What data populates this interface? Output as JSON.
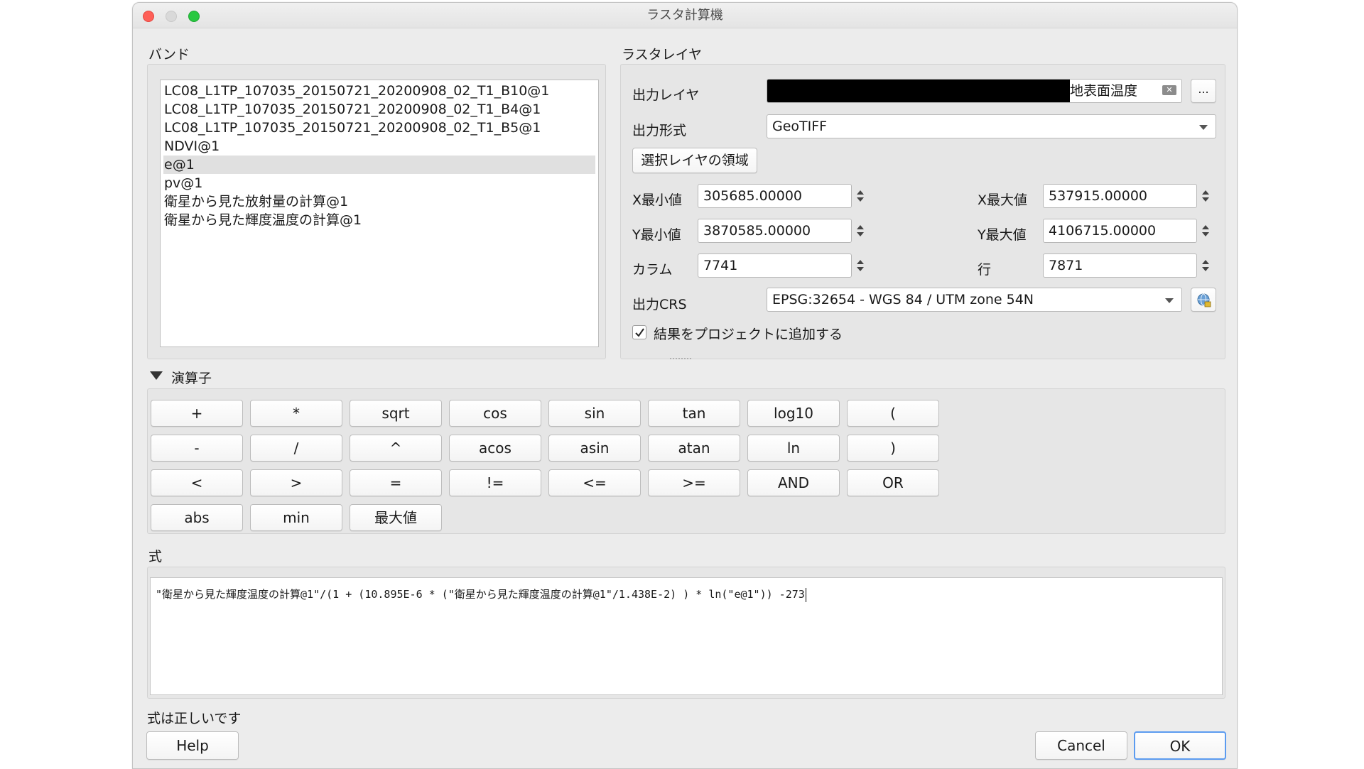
{
  "window": {
    "title": "ラスタ計算機"
  },
  "bands": {
    "label": "バンド",
    "items": [
      "LC08_L1TP_107035_20150721_20200908_02_T1_B10@1",
      "LC08_L1TP_107035_20150721_20200908_02_T1_B4@1",
      "LC08_L1TP_107035_20150721_20200908_02_T1_B5@1",
      "NDVI@1",
      "e@1",
      "pv@1",
      "衛星から見た放射量の計算@1",
      "衛星から見た輝度温度の計算@1"
    ],
    "selected_index": 4
  },
  "raster_layer": {
    "label": "ラスタレイヤ",
    "output_layer_label": "出力レイヤ",
    "output_layer_value": "地表面温度",
    "browse_label": "...",
    "output_format_label": "出力形式",
    "output_format_value": "GeoTIFF",
    "selected_extent_button": "選択レイヤの領域",
    "xmin_label": "X最小値",
    "xmin_value": "305685.00000",
    "xmax_label": "X最大値",
    "xmax_value": "537915.00000",
    "ymin_label": "Y最小値",
    "ymin_value": "3870585.00000",
    "ymax_label": "Y最大値",
    "ymax_value": "4106715.00000",
    "columns_label": "カラム",
    "columns_value": "7741",
    "rows_label": "行",
    "rows_value": "7871",
    "crs_label": "出力CRS",
    "crs_value": "EPSG:32654 - WGS 84 / UTM zone 54N",
    "add_to_project_label": "結果をプロジェクトに追加する",
    "add_to_project_checked": true
  },
  "operators": {
    "label": "演算子",
    "rows": [
      [
        "+",
        "*",
        "sqrt",
        "cos",
        "sin",
        "tan",
        "log10",
        "("
      ],
      [
        "-",
        "/",
        "^",
        "acos",
        "asin",
        "atan",
        "ln",
        ")"
      ],
      [
        "<",
        ">",
        "=",
        "!=",
        "<=",
        ">=",
        "AND",
        "OR"
      ],
      [
        "abs",
        "min",
        "最大値"
      ]
    ]
  },
  "expression": {
    "label": "式",
    "value": "\"衛星から見た輝度温度の計算@1\"/(1 + (10.895E-6 * (\"衛星から見た輝度温度の計算@1\"/1.438E-2) ) * ln(\"e@1\")) -273",
    "status": "式は正しいです"
  },
  "footer": {
    "help_label": "Help",
    "cancel_label": "Cancel",
    "ok_label": "OK"
  },
  "colors": {
    "close": "#fe5f57",
    "minimize": "#d9d9d9",
    "zoom": "#28c840",
    "ok_border": "#5b9bf0"
  }
}
